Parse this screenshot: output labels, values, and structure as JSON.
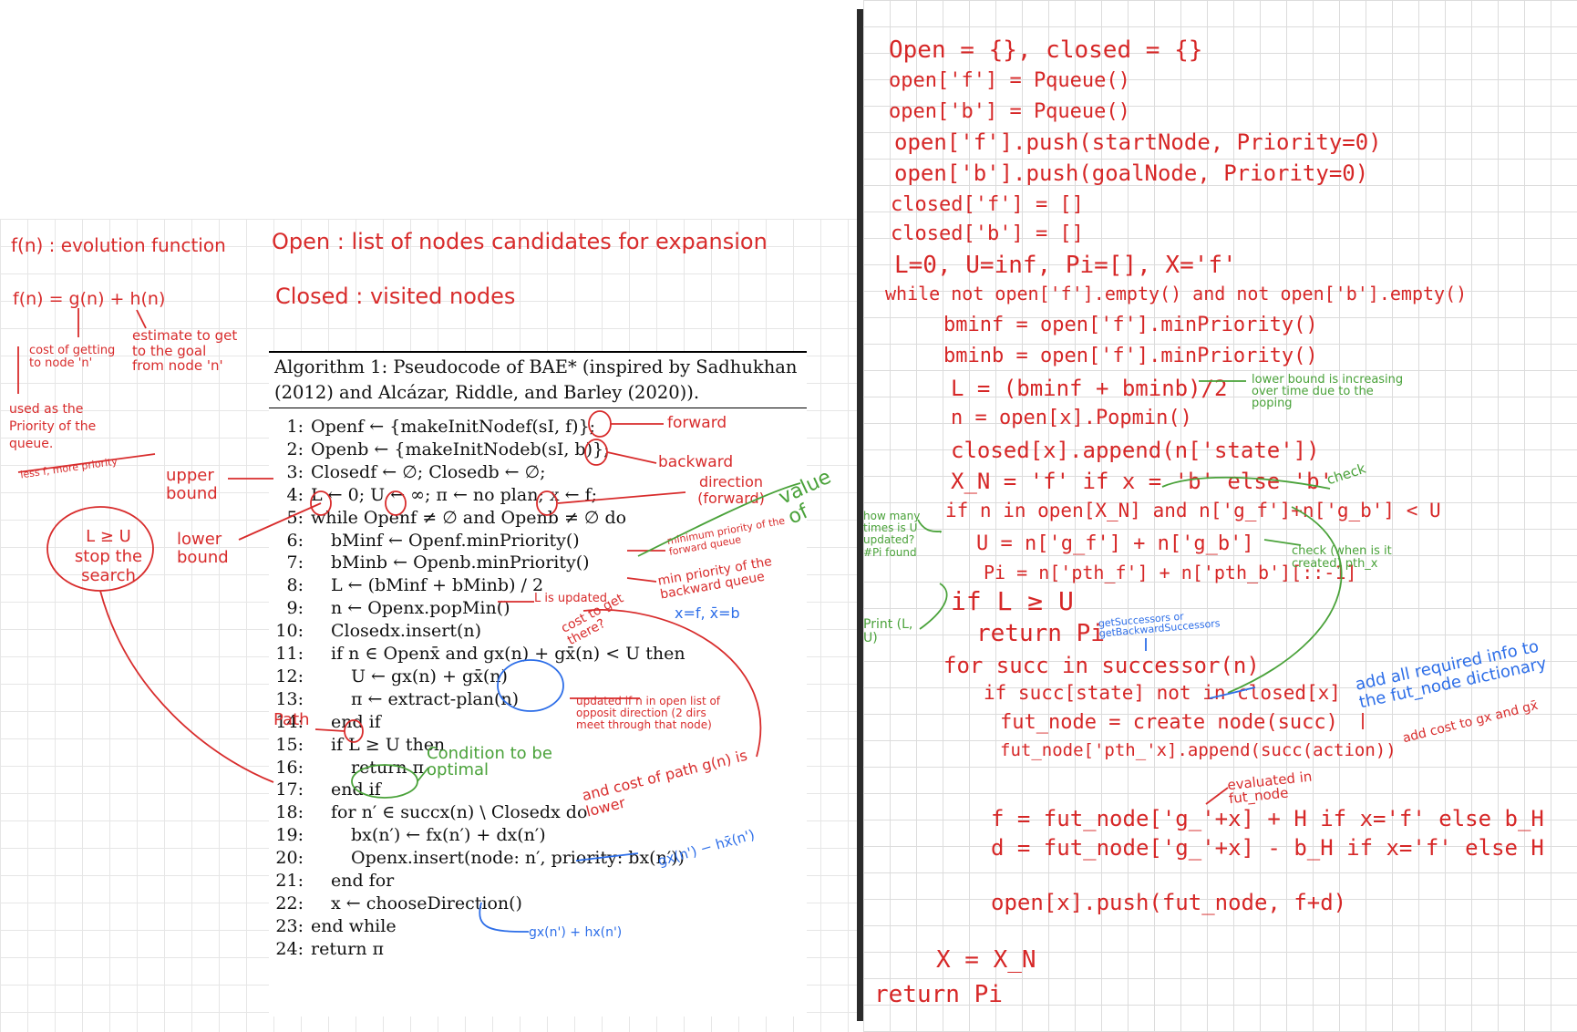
{
  "left_notes": {
    "f_eval": "f(n) : evolution function",
    "f_formula": "f(n) = g(n) + h(n)",
    "cost_of_getting": "cost of getting to node 'n'",
    "estimate": "estimate to get to the goal from node 'n'",
    "used_as_priority": "used as the Priority of the queue.",
    "less_f": "less f, more priority",
    "open_def": "Open : list of nodes candidates for expansion",
    "closed_def": "Closed : visited nodes",
    "upper_bound": "upper bound",
    "lower_bound": "lower bound",
    "stop_search": "L ≥ U stop the search"
  },
  "algorithm": {
    "caption": "Algorithm 1: Pseudocode of BAE* (inspired by Sadhukhan (2012) and Alcázar, Riddle, and Barley (2020)).",
    "lines": [
      {
        "num": "1:",
        "text": "Openf ← {makeInitNodef(sI, f)};"
      },
      {
        "num": "2:",
        "text": "Openb ← {makeInitNodeb(sI, b)};"
      },
      {
        "num": "3:",
        "text": "Closedf ← ∅; Closedb ← ∅;"
      },
      {
        "num": "4:",
        "text": "L ← 0; U ← ∞; π ← no plan; x ← f;"
      },
      {
        "num": "5:",
        "text": "while Openf ≠ ∅ and Openb ≠ ∅ do"
      },
      {
        "num": "6:",
        "text": "bMinf ← Openf.minPriority()"
      },
      {
        "num": "7:",
        "text": "bMinb ← Openb.minPriority()"
      },
      {
        "num": "8:",
        "text": "L ← (bMinf + bMinb) / 2"
      },
      {
        "num": "9:",
        "text": "n ← Openx.popMin()"
      },
      {
        "num": "10:",
        "text": "Closedx.insert(n)"
      },
      {
        "num": "11:",
        "text": "if n ∈ Openx̄ and gx(n) + gx̄(n) < U then"
      },
      {
        "num": "12:",
        "text": "U ← gx(n) + gx̄(n)"
      },
      {
        "num": "13:",
        "text": "π ← extract-plan(n)"
      },
      {
        "num": "14:",
        "text": "end if"
      },
      {
        "num": "15:",
        "text": "if L ≥ U then"
      },
      {
        "num": "16:",
        "text": "return π"
      },
      {
        "num": "17:",
        "text": "end if"
      },
      {
        "num": "18:",
        "text": "for n′ ∈ succx(n) \\ Closedx do"
      },
      {
        "num": "19:",
        "text": "bx(n′) ← fx(n′) + dx(n′)"
      },
      {
        "num": "20:",
        "text": "Openx.insert(node: n′, priority: bx(n′))"
      },
      {
        "num": "21:",
        "text": "end for"
      },
      {
        "num": "22:",
        "text": "x ← chooseDirection()"
      },
      {
        "num": "23:",
        "text": "end while"
      },
      {
        "num": "24:",
        "text": "return π"
      }
    ]
  },
  "annotations": {
    "forward": "forward",
    "backward": "backward",
    "direction": "direction (forward)",
    "value_of": "value of",
    "min_priority_forward": "minimum priority of the forward queue",
    "min_priority_backward": "min priority of the backward queue",
    "l_updated": "L is updated",
    "cost_to_get_there": "cost to get there?",
    "x_values": "x=f, x̄=b",
    "updated_if": "updated if n in open list of opposit direction (2 dirs meet through that node)",
    "and_cost": "and cost of path g(n) is lower",
    "path": "Path",
    "condition_optimal": "Condition to be optimal",
    "blue_top": "gx(n') − hx̄(n')",
    "blue_bottom": "gx(n') + hx(n')"
  },
  "code_lines": [
    "Open = {}, closed = {}",
    "open['f'] = Pqueue()",
    "open['b'] = Pqueue()",
    "open['f'].push(startNode, Priority=0)",
    "open['b'].push(goalNode, Priority=0)",
    "closed['f'] = []",
    "closed['b'] = []",
    "L=0, U=inf, Pi=[], X='f'",
    "while not open['f'].empty() and not open['b'].empty()",
    "bminf = open['f'].minPriority()",
    "bminb = open['f'].minPriority()",
    "L = (bminf + bminb)/2",
    "n = open[x].Popmin()",
    "closed[x].append(n['state'])",
    "X_N = 'f' if x = 'b' else 'b'",
    "if n in open[X_N] and n['g_f']+n['g_b'] < U",
    "U = n['g_f'] + n['g_b']",
    "Pi = n['pth_f'] + n['pth_b'][::-1]",
    "if L ≥ U",
    "return Pi",
    "for succ in successor(n)",
    "if succ[state] not in closed[x]",
    "fut_node = create node(succ)",
    "fut_node['pth_'x].append(succ(action))",
    "f = fut_node['g_'+x] + H if x='f' else b_H",
    "d = fut_node['g_'+x] - b_H if x='f' else H",
    "open[x].push(fut_node, f+d)",
    "X = X_N",
    "return Pi"
  ],
  "right_annotations": {
    "lower_bound_note": "lower bound is increasing over time due to the poping",
    "check1": "check",
    "check2": "check (when is it created) pth_x",
    "how_many": "how many times is U updated? #Pi found",
    "print_lu": "Print (L, U)",
    "successors_note": "getSuccessors or getBackwardSuccessors",
    "add_required": "add all required info to the fut_node dictionary",
    "add_cost": "add cost to gx and gx̄",
    "evaluated": "evaluated in fut_node"
  },
  "colors": {
    "red": "#d82c2c",
    "green": "#4aa23a",
    "blue": "#2d6ee8",
    "divider": "#2b2b2b"
  }
}
